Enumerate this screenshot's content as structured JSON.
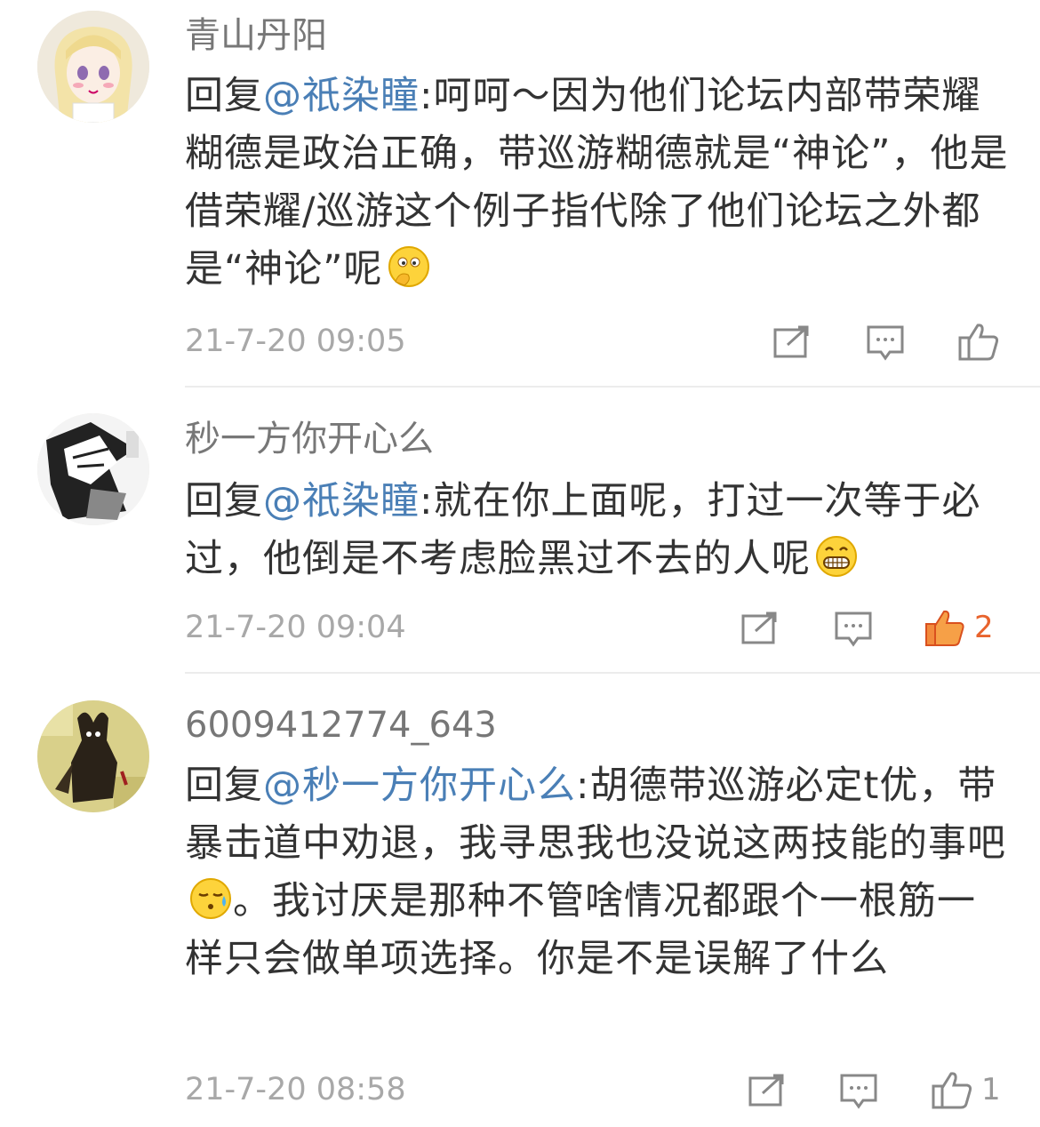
{
  "comments": [
    {
      "username": "青山丹阳",
      "reply_prefix": "回复",
      "mention": "@祇染瞳",
      "text": ":呵呵～因为他们论坛内部带荣耀糊德是政治正确，带巡游糊德就是“神论”，他是借荣耀/巡游这个例子指代除了他们论坛之外都是“神论”呢",
      "emoji": "thinking-emoji",
      "time": "21-7-20 09:05",
      "like_count": "",
      "liked": false
    },
    {
      "username": "秒一方你开心么",
      "reply_prefix": "回复",
      "mention": "@祇染瞳",
      "text": ":就在你上面呢，打过一次等于必过，他倒是不考虑脸黑过不去的人呢",
      "emoji": "grin-emoji",
      "time": "21-7-20 09:04",
      "like_count": "2",
      "liked": true
    },
    {
      "username": "6009412774_643",
      "reply_prefix": "回复",
      "mention": "@秒一方你开心么",
      "text": ":胡德带巡游必定t优，带暴击道中劝退，我寻思我也没说这两技能的事吧",
      "emoji": "sweat-emoji",
      "text_after": "。我讨厌是那种不管啥情况都跟个一根筋一样只会做单项选择。你是不是误解了什么",
      "time": "21-7-20 08:58",
      "like_count": "1",
      "liked": false
    }
  ],
  "colors": {
    "mention": "#4a7fb6",
    "like_active": "#e8632d",
    "meta": "#a8a8a8"
  }
}
